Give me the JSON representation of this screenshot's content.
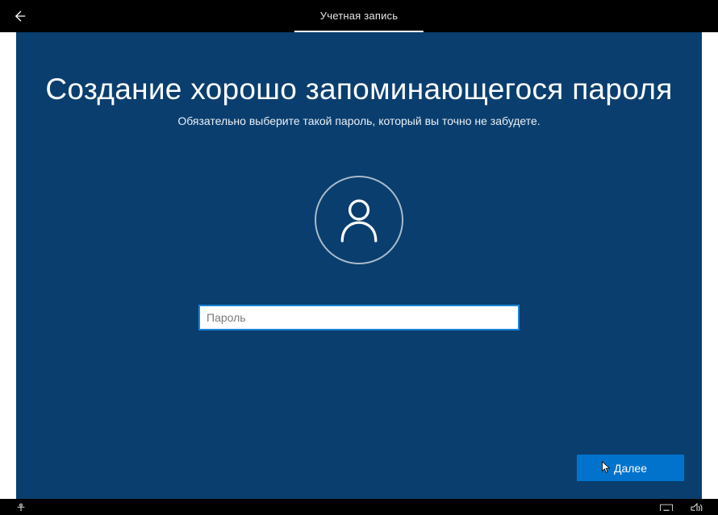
{
  "header": {
    "tab_label": "Учетная запись"
  },
  "content": {
    "headline": "Создание хорошо запоминающегося пароля",
    "subhead": "Обязательно выберите такой пароль, который вы точно не забудете.",
    "password_placeholder": "Пароль",
    "password_value": ""
  },
  "actions": {
    "next_label": "Далее"
  },
  "colors": {
    "page_bg": "#0a3e6e",
    "accent": "#0173cc",
    "input_border": "#1a83d8"
  }
}
